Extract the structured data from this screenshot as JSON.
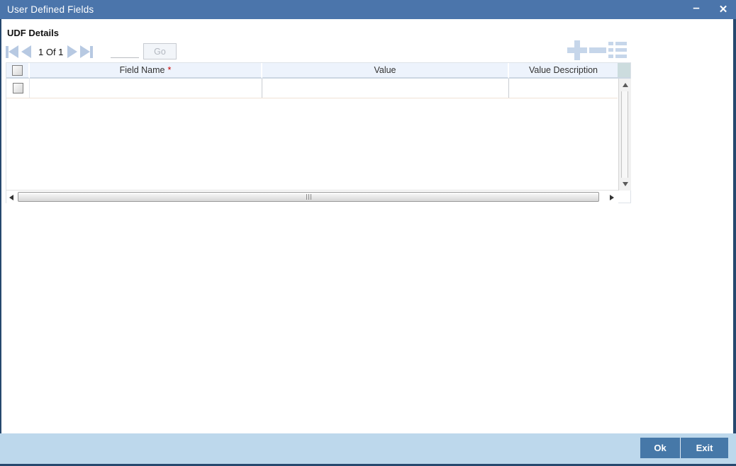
{
  "window": {
    "title": "User Defined Fields",
    "minimize_glyph": "–",
    "close_glyph": "✕"
  },
  "section": {
    "title": "UDF Details"
  },
  "pagination": {
    "page_label": "1 Of 1",
    "goto_value": "",
    "go_label": "Go",
    "icons": {
      "first": "first-page-icon",
      "previous": "previous-page-icon",
      "next": "next-page-icon",
      "last": "last-page-icon"
    }
  },
  "record_actions": {
    "add": "plus-icon",
    "remove": "minus-icon",
    "details": "list-icon"
  },
  "table": {
    "required_marker": "*",
    "columns": [
      {
        "label": "Field Name",
        "required": true
      },
      {
        "label": "Value",
        "required": false
      },
      {
        "label": "Value Description",
        "required": false
      }
    ],
    "rows": [
      {
        "field_name": "",
        "value": "",
        "value_description": "",
        "selected": false
      }
    ]
  },
  "footer": {
    "ok_label": "Ok",
    "exit_label": "Exit"
  },
  "colors": {
    "titlebar_bg": "#4b75ab",
    "window_border": "#26486e",
    "header_bg": "#edf3fc",
    "header_separator": "#ccd7e3",
    "footer_bg": "#bdd8ec",
    "button_bg": "#4678a8",
    "pager_icon": "#b7c9e2",
    "record_icon": "#c6d6ea",
    "required_asterisk": "#cc0000",
    "scroll_corner": "#ccdcde"
  }
}
